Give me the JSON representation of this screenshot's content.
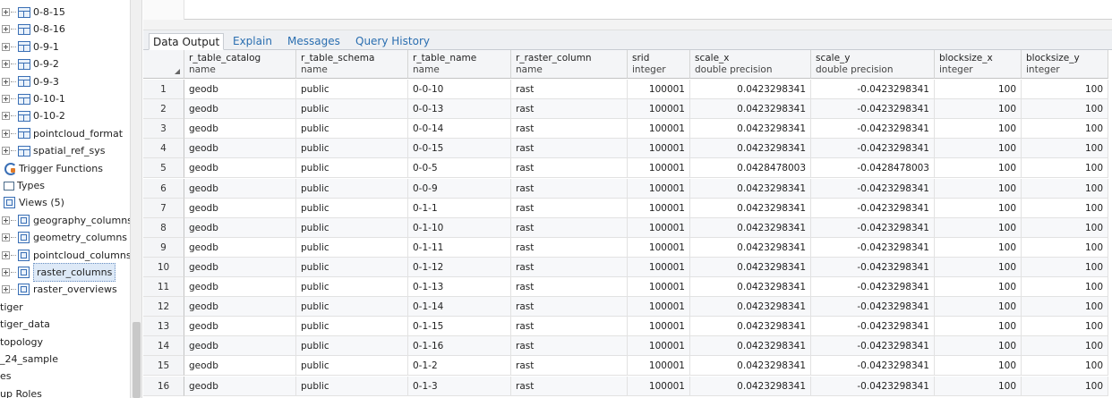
{
  "tree": {
    "items": [
      {
        "label": "0-8-15",
        "kind": "table"
      },
      {
        "label": "0-8-16",
        "kind": "table"
      },
      {
        "label": "0-9-1",
        "kind": "table"
      },
      {
        "label": "0-9-2",
        "kind": "table"
      },
      {
        "label": "0-9-3",
        "kind": "table"
      },
      {
        "label": "0-10-1",
        "kind": "table"
      },
      {
        "label": "0-10-2",
        "kind": "table"
      },
      {
        "label": "pointcloud_format",
        "kind": "table"
      },
      {
        "label": "spatial_ref_sys",
        "kind": "table"
      },
      {
        "label": "Trigger Functions",
        "kind": "trigger"
      },
      {
        "label": "Types",
        "kind": "types"
      },
      {
        "label": "Views (5)",
        "kind": "views"
      },
      {
        "label": "geography_columns",
        "kind": "view"
      },
      {
        "label": "geometry_columns",
        "kind": "view"
      },
      {
        "label": "pointcloud_columns",
        "kind": "view"
      },
      {
        "label": "raster_columns",
        "kind": "view",
        "selected": true
      },
      {
        "label": "raster_overviews",
        "kind": "view"
      },
      {
        "label": "tiger",
        "kind": "schema"
      },
      {
        "label": "tiger_data",
        "kind": "schema"
      },
      {
        "label": "topology",
        "kind": "schema"
      },
      {
        "label": "_24_sample",
        "kind": "schema"
      },
      {
        "label": "es",
        "kind": "schema"
      },
      {
        "label": "up Roles",
        "kind": "schema"
      }
    ]
  },
  "tabs": [
    "Data Output",
    "Explain",
    "Messages",
    "Query History"
  ],
  "active_tab": "Data Output",
  "columns": [
    {
      "name": "r_table_catalog",
      "type": "name"
    },
    {
      "name": "r_table_schema",
      "type": "name"
    },
    {
      "name": "r_table_name",
      "type": "name"
    },
    {
      "name": "r_raster_column",
      "type": "name"
    },
    {
      "name": "srid",
      "type": "integer"
    },
    {
      "name": "scale_x",
      "type": "double precision"
    },
    {
      "name": "scale_y",
      "type": "double precision"
    },
    {
      "name": "blocksize_x",
      "type": "integer"
    },
    {
      "name": "blocksize_y",
      "type": "integer"
    }
  ],
  "rows": [
    [
      "1",
      "geodb",
      "public",
      "0-0-10",
      "rast",
      "100001",
      "0.0423298341",
      "-0.0423298341",
      "100",
      "100"
    ],
    [
      "2",
      "geodb",
      "public",
      "0-0-13",
      "rast",
      "100001",
      "0.0423298341",
      "-0.0423298341",
      "100",
      "100"
    ],
    [
      "3",
      "geodb",
      "public",
      "0-0-14",
      "rast",
      "100001",
      "0.0423298341",
      "-0.0423298341",
      "100",
      "100"
    ],
    [
      "4",
      "geodb",
      "public",
      "0-0-15",
      "rast",
      "100001",
      "0.0423298341",
      "-0.0423298341",
      "100",
      "100"
    ],
    [
      "5",
      "geodb",
      "public",
      "0-0-5",
      "rast",
      "100001",
      "0.0428478003",
      "-0.0428478003",
      "100",
      "100"
    ],
    [
      "6",
      "geodb",
      "public",
      "0-0-9",
      "rast",
      "100001",
      "0.0423298341",
      "-0.0423298341",
      "100",
      "100"
    ],
    [
      "7",
      "geodb",
      "public",
      "0-1-1",
      "rast",
      "100001",
      "0.0423298341",
      "-0.0423298341",
      "100",
      "100"
    ],
    [
      "8",
      "geodb",
      "public",
      "0-1-10",
      "rast",
      "100001",
      "0.0423298341",
      "-0.0423298341",
      "100",
      "100"
    ],
    [
      "9",
      "geodb",
      "public",
      "0-1-11",
      "rast",
      "100001",
      "0.0423298341",
      "-0.0423298341",
      "100",
      "100"
    ],
    [
      "10",
      "geodb",
      "public",
      "0-1-12",
      "rast",
      "100001",
      "0.0423298341",
      "-0.0423298341",
      "100",
      "100"
    ],
    [
      "11",
      "geodb",
      "public",
      "0-1-13",
      "rast",
      "100001",
      "0.0423298341",
      "-0.0423298341",
      "100",
      "100"
    ],
    [
      "12",
      "geodb",
      "public",
      "0-1-14",
      "rast",
      "100001",
      "0.0423298341",
      "-0.0423298341",
      "100",
      "100"
    ],
    [
      "13",
      "geodb",
      "public",
      "0-1-15",
      "rast",
      "100001",
      "0.0423298341",
      "-0.0423298341",
      "100",
      "100"
    ],
    [
      "14",
      "geodb",
      "public",
      "0-1-16",
      "rast",
      "100001",
      "0.0423298341",
      "-0.0423298341",
      "100",
      "100"
    ],
    [
      "15",
      "geodb",
      "public",
      "0-1-2",
      "rast",
      "100001",
      "0.0423298341",
      "-0.0423298341",
      "100",
      "100"
    ],
    [
      "16",
      "geodb",
      "public",
      "0-1-3",
      "rast",
      "100001",
      "0.0423298341",
      "-0.0423298341",
      "100",
      "100"
    ]
  ]
}
